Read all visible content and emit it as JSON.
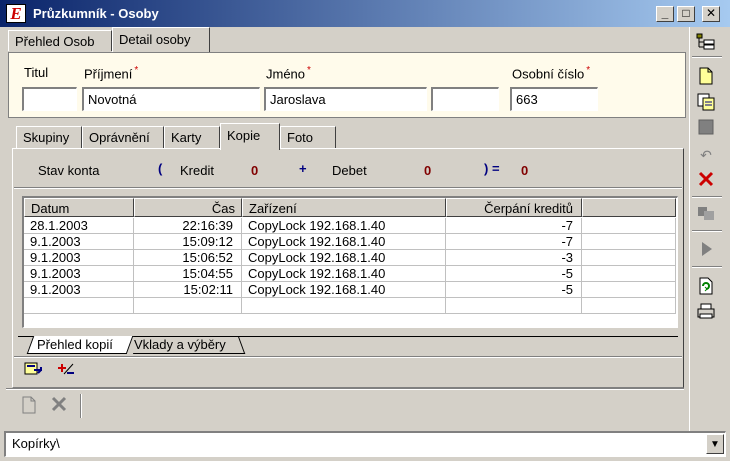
{
  "window": {
    "title": "Průzkumník - Osoby",
    "app_icon": "E"
  },
  "main_tabs": [
    {
      "label": "Přehled Osob"
    },
    {
      "label": "Detail osoby"
    }
  ],
  "person": {
    "titul_label": "Titul",
    "prijmeni_label": "Příjmení",
    "jmeno_label": "Jméno",
    "osobni_label": "Osobní číslo",
    "required_mark": "*",
    "titul_value": "",
    "prijmeni_value": "Novotná",
    "jmeno_value": "Jaroslava",
    "extra_value": "",
    "osobni_value": "663"
  },
  "sub_tabs": [
    {
      "label": "Skupiny"
    },
    {
      "label": "Oprávnění"
    },
    {
      "label": "Karty"
    },
    {
      "label": "Kopie"
    },
    {
      "label": "Foto"
    }
  ],
  "account": {
    "label": "Stav konta",
    "open_paren": "(",
    "kredit_label": "Kredit",
    "kredit_value": "0",
    "plus": "+",
    "debet_label": "Debet",
    "debet_value": "0",
    "close_eq": ") =",
    "total_value": "0"
  },
  "grid": {
    "columns": [
      "Datum",
      "Čas",
      "Zařízení",
      "Čerpání kreditů"
    ],
    "rows": [
      [
        "28.1.2003",
        "22:16:39",
        "CopyLock 192.168.1.40",
        "-7"
      ],
      [
        "9.1.2003",
        "15:09:12",
        "CopyLock 192.168.1.40",
        "-7"
      ],
      [
        "9.1.2003",
        "15:06:52",
        "CopyLock 192.168.1.40",
        "-3"
      ],
      [
        "9.1.2003",
        "15:04:55",
        "CopyLock 192.168.1.40",
        "-5"
      ],
      [
        "9.1.2003",
        "15:02:11",
        "CopyLock 192.168.1.40",
        "-5"
      ]
    ]
  },
  "bottom_tabs": [
    {
      "label": "Přehled kopií"
    },
    {
      "label": "Vklady a výběry"
    }
  ],
  "statusbar": {
    "path": "Kopírky\\"
  },
  "colors": {
    "accent_red": "#cc0000",
    "accent_blue": "#000080",
    "form_bg": "#fffbeb"
  }
}
